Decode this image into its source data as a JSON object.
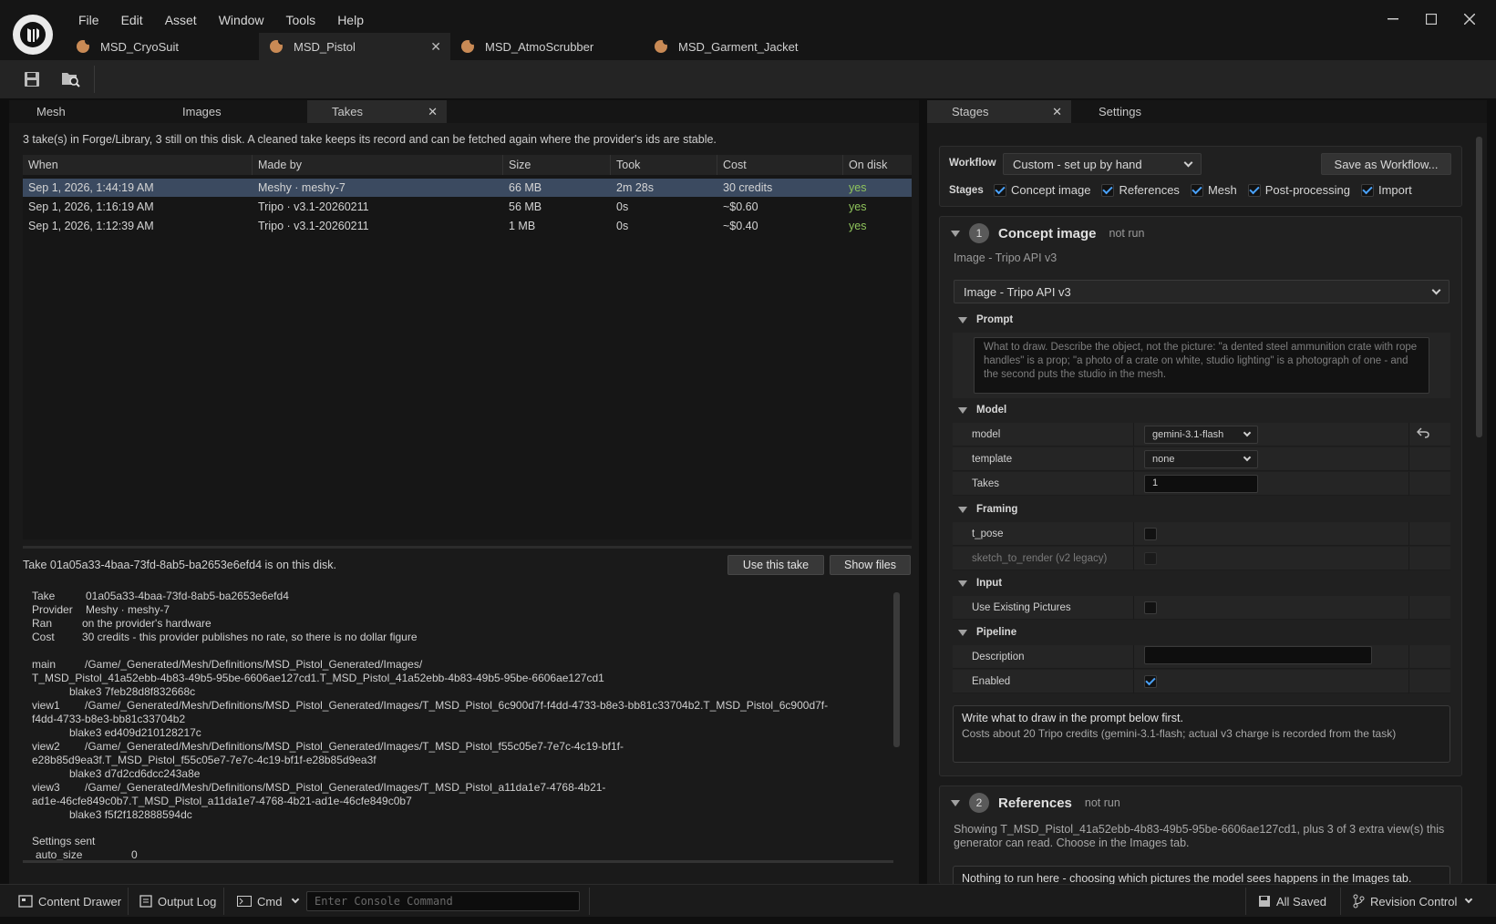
{
  "menu": [
    "File",
    "Edit",
    "Asset",
    "Window",
    "Tools",
    "Help"
  ],
  "doc_tabs": [
    {
      "label": "MSD_CryoSuit"
    },
    {
      "label": "MSD_Pistol",
      "active": true
    },
    {
      "label": "MSD_AtmoScrubber"
    },
    {
      "label": "MSD_Garment_Jacket"
    }
  ],
  "left_tabs": {
    "mesh": "Mesh",
    "images": "Images",
    "takes": "Takes"
  },
  "summary": "3 take(s) in Forge/Library, 3 still on this disk. A cleaned take keeps its record and can be fetched again where the provider's ids are stable.",
  "table": {
    "headers": [
      "When",
      "Made by",
      "Size",
      "Took",
      "Cost",
      "On disk"
    ],
    "rows": [
      [
        "Sep 1, 2026, 1:44:19 AM",
        "Meshy · meshy-7",
        "66 MB",
        "2m 28s",
        "30 credits",
        "yes"
      ],
      [
        "Sep 1, 2026, 1:16:19 AM",
        "Tripo · v3.1-20260211",
        "56 MB",
        "0s",
        "~$0.60",
        "yes"
      ],
      [
        "Sep 1, 2026, 1:12:39 AM",
        "Tripo · v3.1-20260211",
        "1 MB",
        "0s",
        "~$0.40",
        "yes"
      ]
    ]
  },
  "take_info": "Take 01a05a33-4baa-73fd-8ab5-ba2653e6efd4 is on this disk.",
  "buttons": {
    "use_take": "Use this take",
    "show_files": "Show files"
  },
  "details": [
    {
      "k": "Take",
      "v": "01a05a33-4baa-73fd-8ab5-ba2653e6efd4"
    },
    {
      "k": "Provider",
      "v": "Meshy  ·  meshy-7"
    },
    {
      "k": "Ran",
      "v": "on the provider's hardware"
    },
    {
      "k": "Cost",
      "v": "30 credits  -  this provider publishes no rate, so there is no dollar figure"
    }
  ],
  "files": [
    {
      "k": "main",
      "l1": "/Game/_Generated/Mesh/Definitions/MSD_Pistol_Generated/Images/",
      "l2": "T_MSD_Pistol_41a52ebb-4b83-49b5-95be-6606ae127cd1.T_MSD_Pistol_41a52ebb-4b83-49b5-95be-6606ae127cd1",
      "hash": "blake3 7feb28d8f832668c"
    },
    {
      "k": "view1",
      "l1": "/Game/_Generated/Mesh/Definitions/MSD_Pistol_Generated/Images/T_MSD_Pistol_6c900d7f-f4dd-4733-b8e3-bb81c33704b2.T_MSD_Pistol_6c900d7f-",
      "l2": "f4dd-4733-b8e3-bb81c33704b2",
      "hash": "blake3 ed409d210128217c"
    },
    {
      "k": "view2",
      "l1": "/Game/_Generated/Mesh/Definitions/MSD_Pistol_Generated/Images/T_MSD_Pistol_f55c05e7-7e7c-4c19-bf1f-",
      "l2": "e28b85d9ea3f.T_MSD_Pistol_f55c05e7-7e7c-4c19-bf1f-e28b85d9ea3f",
      "hash": "blake3 d7d2cd6dcc243a8e"
    },
    {
      "k": "view3",
      "l1": "/Game/_Generated/Mesh/Definitions/MSD_Pistol_Generated/Images/T_MSD_Pistol_a11da1e7-4768-4b21-",
      "l2": "ad1e-46cfe849c0b7.T_MSD_Pistol_a11da1e7-4768-4b21-ad1e-46cfe849c0b7",
      "hash": "blake3 f5f2f182888594dc"
    }
  ],
  "settings_sent": {
    "title": "Settings sent",
    "k": "auto_size",
    "v": "0"
  },
  "right_tabs": {
    "stages": "Stages",
    "settings": "Settings"
  },
  "workflow": {
    "label": "Workflow",
    "value": "Custom - set up by hand",
    "save": "Save as Workflow..."
  },
  "stages": {
    "label": "Stages",
    "items": [
      "Concept image",
      "References",
      "Mesh",
      "Post-processing",
      "Import"
    ]
  },
  "concept": {
    "num": "1",
    "title": "Concept image",
    "status": "not run",
    "subtitle": "Image - Tripo API v3",
    "provider": "Image - Tripo API v3",
    "prompt_cat": "Prompt",
    "prompt_placeholder": "What to draw. Describe the object, not the picture: \"a dented steel ammunition crate with rope handles\" is a prop; \"a photo of a crate on white, studio lighting\" is a photograph of one - and the second puts the studio in the mesh.",
    "model_cat": "Model",
    "model_label": "model",
    "model_value": "gemini-3.1-flash",
    "template_label": "template",
    "template_value": "none",
    "takes_label": "Takes",
    "takes_value": "1",
    "framing_cat": "Framing",
    "tpose": "t_pose",
    "sketch": "sketch_to_render (v2 legacy)",
    "input_cat": "Input",
    "use_existing": "Use Existing Pictures",
    "pipeline_cat": "Pipeline",
    "description": "Description",
    "enabled": "Enabled",
    "note_title": "Write what to draw in the prompt below first.",
    "note_body": "Costs about 20 Tripo credits (gemini-3.1-flash; actual v3 charge is recorded from the task)"
  },
  "references": {
    "num": "2",
    "title": "References",
    "status": "not run",
    "body": "Showing T_MSD_Pistol_41a52ebb-4b83-49b5-95be-6606ae127cd1, plus 3 of 3 extra view(s) this generator can read. Choose in the Images tab.",
    "note": "Nothing to run here - choosing which pictures the model sees happens in the Images tab."
  },
  "status": {
    "content_drawer": "Content Drawer",
    "output_log": "Output Log",
    "cmd": "Cmd",
    "console_placeholder": "Enter Console Command",
    "saved": "All Saved",
    "revision": "Revision Control"
  }
}
